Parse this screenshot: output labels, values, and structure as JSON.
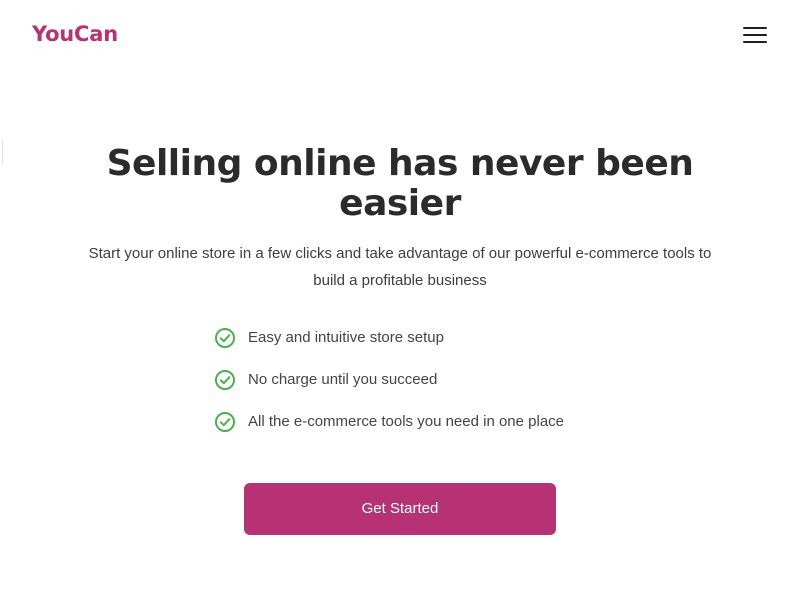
{
  "brand": {
    "name": "YouCan",
    "color": "#b73274"
  },
  "header": {
    "menu_icon": "hamburger-menu-icon"
  },
  "hero": {
    "title": "Selling online has never been easier",
    "subtitle": "Start your online store in a few clicks and take advantage of our powerful e-commerce tools to build a profitable business"
  },
  "features": {
    "icon": "check-circle-icon",
    "icon_color": "#4caf50",
    "items": [
      {
        "label": "Easy and intuitive store setup"
      },
      {
        "label": "No charge until you succeed"
      },
      {
        "label": "All the e-commerce tools you need in one place"
      }
    ]
  },
  "cta": {
    "label": "Get Started",
    "background": "#b73274",
    "text_color": "#ffffff"
  }
}
